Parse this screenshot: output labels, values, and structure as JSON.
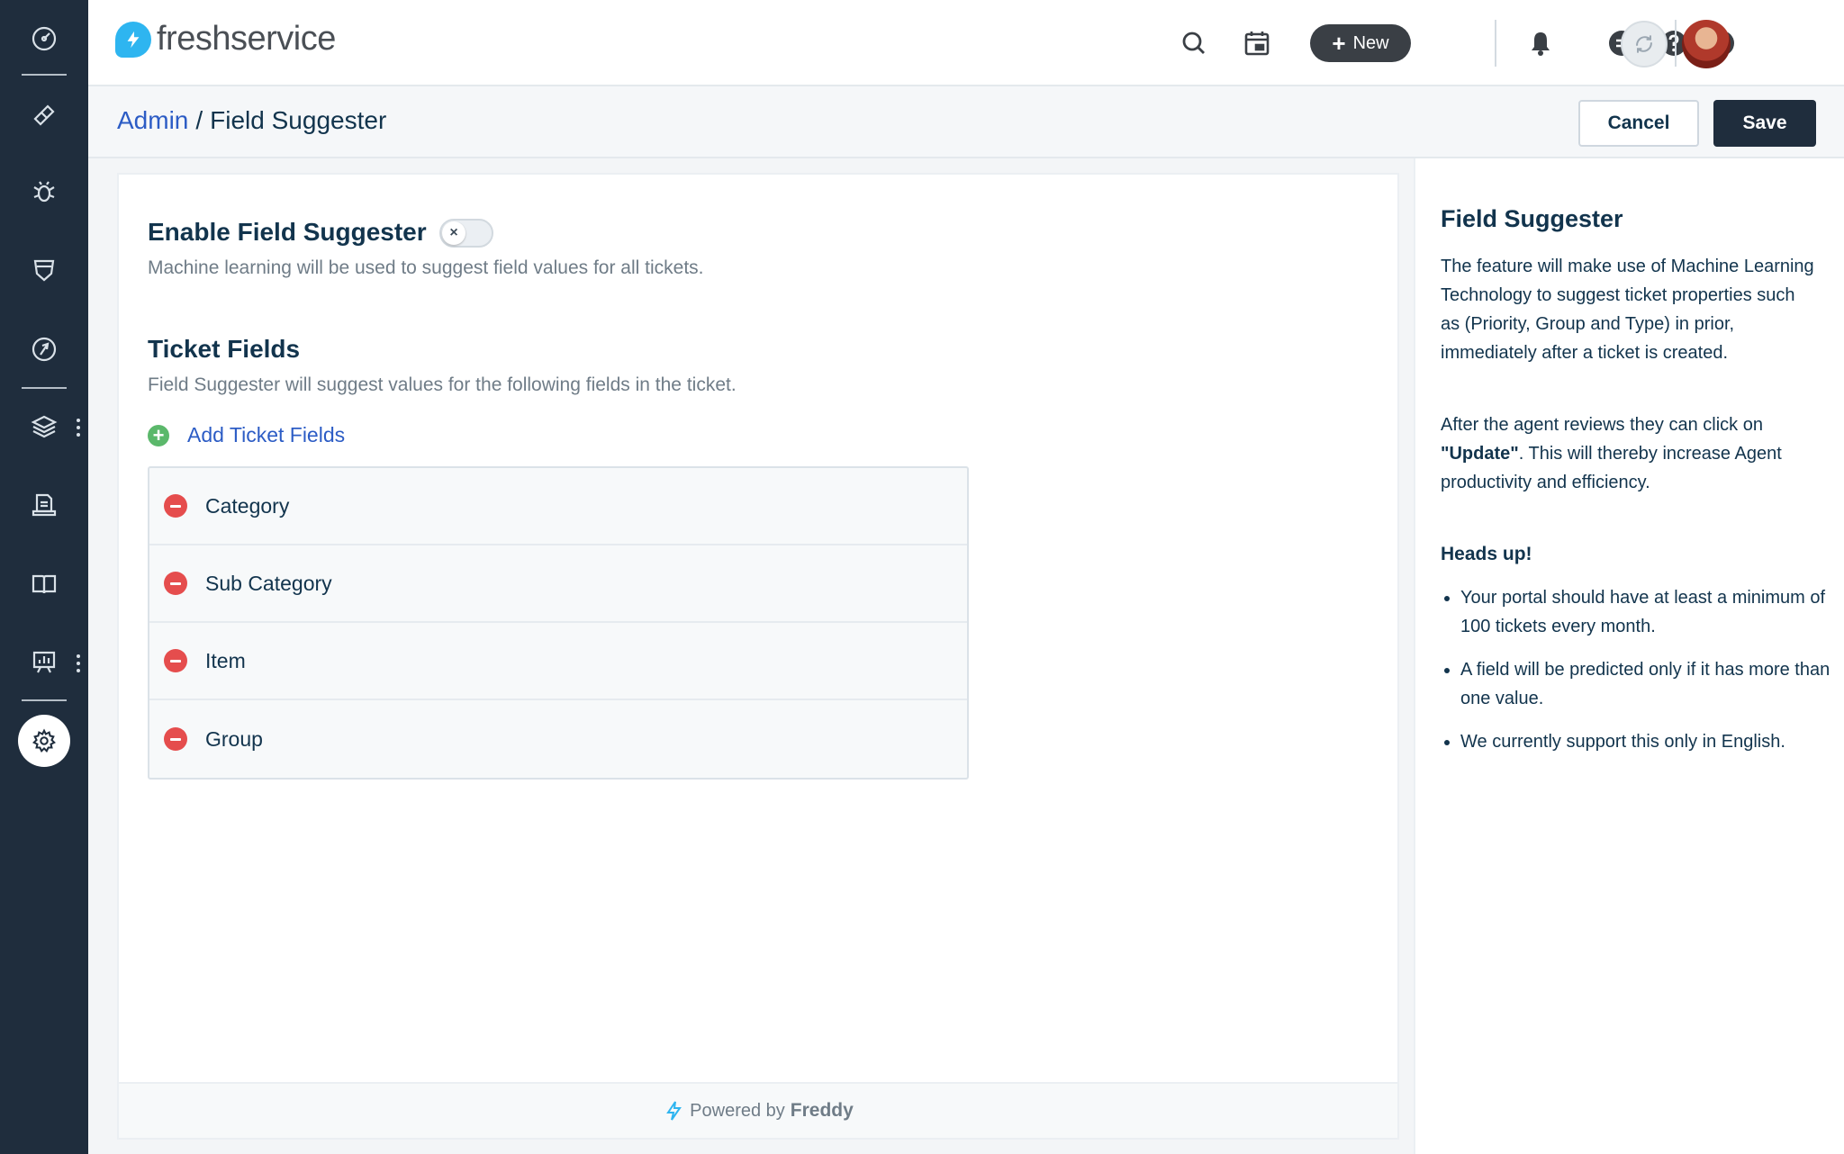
{
  "app": {
    "brand": "freshservice"
  },
  "topbar": {
    "new_button_label": "New"
  },
  "breadcrumb": {
    "parent": "Admin",
    "separator": "/",
    "current": "Field Suggester"
  },
  "actions": {
    "cancel_label": "Cancel",
    "save_label": "Save"
  },
  "enable_section": {
    "title": "Enable Field Suggester",
    "toggle_symbol": "×",
    "toggle_on": false,
    "description": "Machine learning will be used to suggest field values for all tickets."
  },
  "ticket_fields": {
    "title": "Ticket Fields",
    "description": "Field Suggester will suggest values for the following fields in the ticket.",
    "add_label": "Add Ticket Fields",
    "fields": [
      "Category",
      "Sub Category",
      "Item",
      "Group"
    ]
  },
  "footer": {
    "powered_by": "Powered by",
    "brand": "Freddy"
  },
  "help_panel": {
    "title": "Field Suggester",
    "para1": "The feature will make use of Machine Learning Technology to suggest ticket properties such as (Priority, Group and Type) in prior, immediately after a ticket is created.",
    "para2_prefix": "After the agent reviews they can click on ",
    "para2_bold": "\"Update\"",
    "para2_suffix": ". This will thereby increase Agent productivity and efficiency.",
    "heads_up": "Heads up!",
    "bullets": [
      "Your portal should have at least a minimum of 100 tickets every month.",
      "A field will be predicted only if it has more than one value.",
      "We currently support this only in English."
    ]
  },
  "colors": {
    "sidebar": "#1f2d3d",
    "link": "#2c5cc5",
    "primary_button": "#1f2d3d",
    "remove": "#e54d4d",
    "add": "#5bb86b",
    "brand": "#2eb5f0"
  },
  "icons": {
    "sidebar": [
      "dashboard-icon",
      "tickets-icon",
      "problems-icon",
      "changes-icon",
      "releases-icon",
      "assets-icon",
      "contracts-icon",
      "solutions-icon",
      "reports-icon",
      "admin-gear-icon"
    ],
    "topbar": [
      "search-icon",
      "calendar-icon",
      "plus-icon",
      "bell-icon",
      "chat-icon",
      "help-icon",
      "info-icon",
      "refresh-icon",
      "user-avatar"
    ]
  }
}
